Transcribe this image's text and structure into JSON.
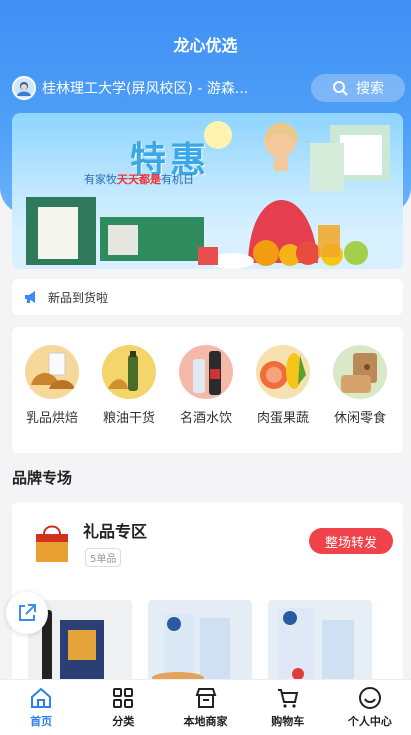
{
  "app": {
    "title": "龙心优选"
  },
  "header": {
    "location": "桂林理工大学(屏风校区) - 游森...",
    "search_label": "搜索",
    "search_icon": "search-icon"
  },
  "banner": {
    "title": "特惠",
    "sub_prefix": "有家牧",
    "sub_highlight": "天天都是",
    "sub_suffix": "有机日"
  },
  "notice": {
    "text": "新品到货啦",
    "icon": "megaphone-icon"
  },
  "categories": [
    {
      "label": "乳品烘焙"
    },
    {
      "label": "粮油干货"
    },
    {
      "label": "名酒水饮"
    },
    {
      "label": "肉蛋果蔬"
    },
    {
      "label": "休闲零食"
    }
  ],
  "brand_section": {
    "title": "品牌专场",
    "card": {
      "name": "礼品专区",
      "count": "5单品",
      "forward_label": "整场转发"
    }
  },
  "tabbar": [
    {
      "label": "首页",
      "icon": "home-icon"
    },
    {
      "label": "分类",
      "icon": "grid-icon"
    },
    {
      "label": "本地商家",
      "icon": "store-icon"
    },
    {
      "label": "购物车",
      "icon": "cart-icon"
    },
    {
      "label": "个人中心",
      "icon": "smiley-icon"
    }
  ],
  "colors": {
    "primary": "#2f7ff0",
    "header": "#4a98f6",
    "forward": "#f0424a"
  }
}
